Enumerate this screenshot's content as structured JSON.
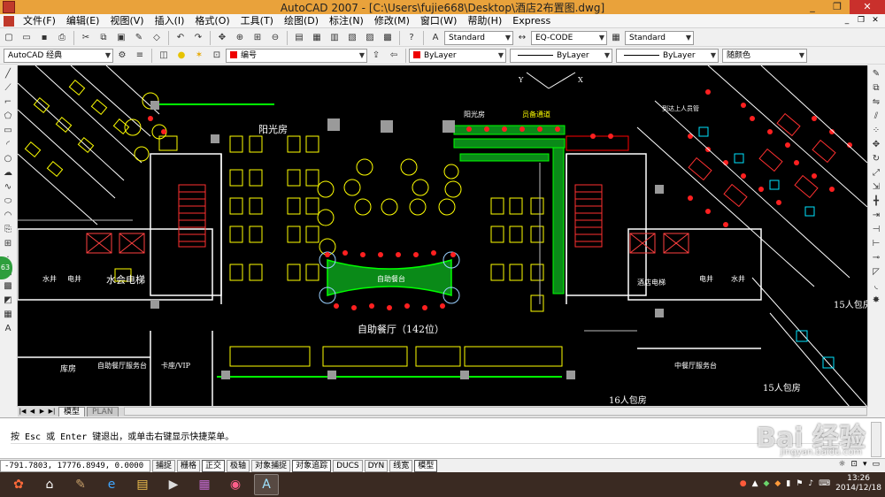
{
  "window": {
    "title": "AutoCAD 2007 - [C:\\Users\\fujie668\\Desktop\\酒店2布置图.dwg]",
    "min": "_",
    "restore": "❐",
    "close": "✕"
  },
  "menu": [
    "文件(F)",
    "编辑(E)",
    "视图(V)",
    "插入(I)",
    "格式(O)",
    "工具(T)",
    "绘图(D)",
    "标注(N)",
    "修改(M)",
    "窗口(W)",
    "帮助(H)",
    "Express"
  ],
  "toolbar": {
    "text_style": "Standard",
    "dim_style": "EQ-CODE",
    "table_style": "Standard",
    "workspace": "AutoCAD 经典",
    "layer": "编号",
    "color": "ByLayer",
    "linetype": "ByLayer",
    "lineweight": "ByLayer",
    "plotstyle": "随颜色"
  },
  "side_badge": "63",
  "drawing_labels": {
    "sunroom": "阳光房",
    "sunroom_small": "阳光房",
    "passage": "员备通道",
    "elevator": "水会电梯",
    "water": "水井",
    "electric": "电井",
    "buffet_counter": "自助餐台",
    "buffet_hall": "自助餐厅（142位）",
    "storeroom": "库房",
    "buffet_service": "自助餐厅服务台",
    "card_vip": "卡座/VIP",
    "hotel_elevator": "酒店电梯",
    "chinese_service": "中餐厅服务台",
    "room16": "16人包房",
    "room15a": "15人包房",
    "room15b": "15人包房",
    "lounge": "到达上人员管",
    "axis_y": "Y",
    "axis_x": "X"
  },
  "tabs": [
    "模型",
    "PLAN"
  ],
  "command_text": "按 Esc 或 Enter 键退出，或单击右键显示快捷菜单。",
  "status": {
    "coords": "-791.7803,  17776.8949,  0.0000",
    "buttons": [
      {
        "label": "捕捉",
        "on": false
      },
      {
        "label": "栅格",
        "on": false
      },
      {
        "label": "正交",
        "on": true
      },
      {
        "label": "极轴",
        "on": false
      },
      {
        "label": "对象捕捉",
        "on": false
      },
      {
        "label": "对象追踪",
        "on": true
      },
      {
        "label": "DUCS",
        "on": false
      },
      {
        "label": "DYN",
        "on": false
      },
      {
        "label": "线宽",
        "on": false
      },
      {
        "label": "模型",
        "on": true
      }
    ]
  },
  "watermark": "Bai 经验",
  "watermark_sub": "jingyan.baidu.com",
  "clock": {
    "time": "13:26",
    "date": "2014/12/18"
  }
}
